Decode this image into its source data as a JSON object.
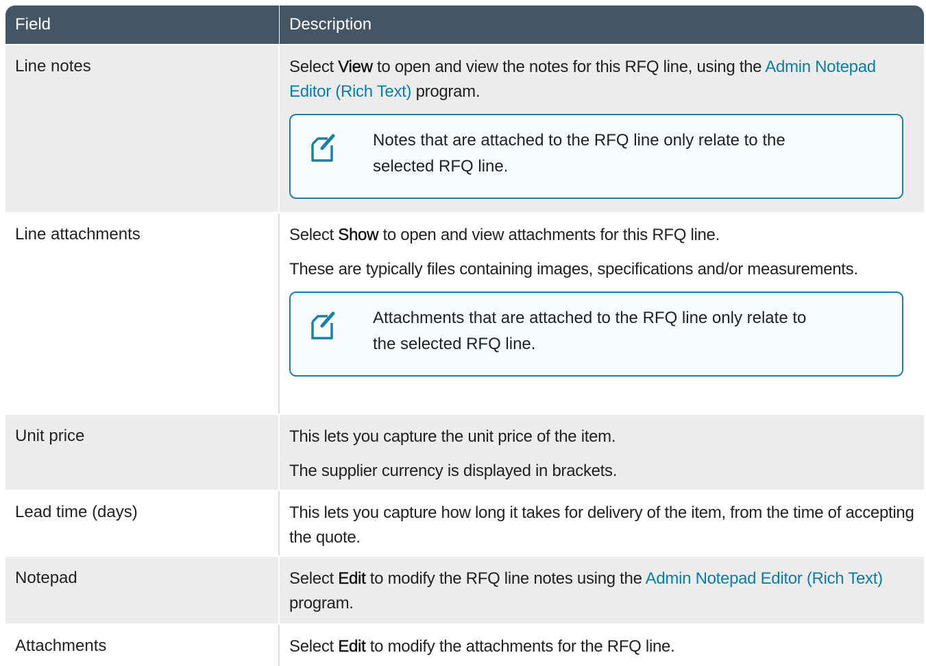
{
  "headers": {
    "field": "Field",
    "description": "Description"
  },
  "rows": [
    {
      "field": "Line notes",
      "p1": {
        "pre": "Select ",
        "kw": "View",
        "mid": " to open and view the notes for this RFQ line, using the ",
        "link": "Admin Notepad Editor (Rich Text)",
        "post": " program."
      },
      "note": "Notes that are attached to the RFQ line only relate to the selected RFQ line."
    },
    {
      "field": "Line attachments",
      "p1": {
        "pre": "Select ",
        "kw": "Show",
        "post": " to open and view attachments for this RFQ line."
      },
      "p2": "These are typically files containing images, specifications and/or measurements.",
      "note": "Attachments that are attached to the RFQ line only relate to the selected RFQ line."
    },
    {
      "field": "Unit price",
      "p1": "This lets you capture the unit price of the item.",
      "p2": "The supplier currency is displayed in brackets."
    },
    {
      "field": "Lead time (days)",
      "p1": "This lets you capture how long it takes for delivery of the item, from the time of accepting the quote."
    },
    {
      "field": "Notepad",
      "p1": {
        "pre": "Select ",
        "kw": "Edit",
        "mid": " to modify the RFQ line notes using the ",
        "link": "Admin Notepad Editor (Rich Text)",
        "post": " program."
      }
    },
    {
      "field": "Attachments",
      "p1": {
        "pre": "Select ",
        "kw": "Edit",
        "post": " to modify the attachments for the RFQ line."
      }
    }
  ],
  "icon": "note-edit-icon",
  "colors": {
    "header": "#445563",
    "link": "#0a7fa3",
    "note_border": "#1d7fa5",
    "row_alt": "#ececec"
  }
}
